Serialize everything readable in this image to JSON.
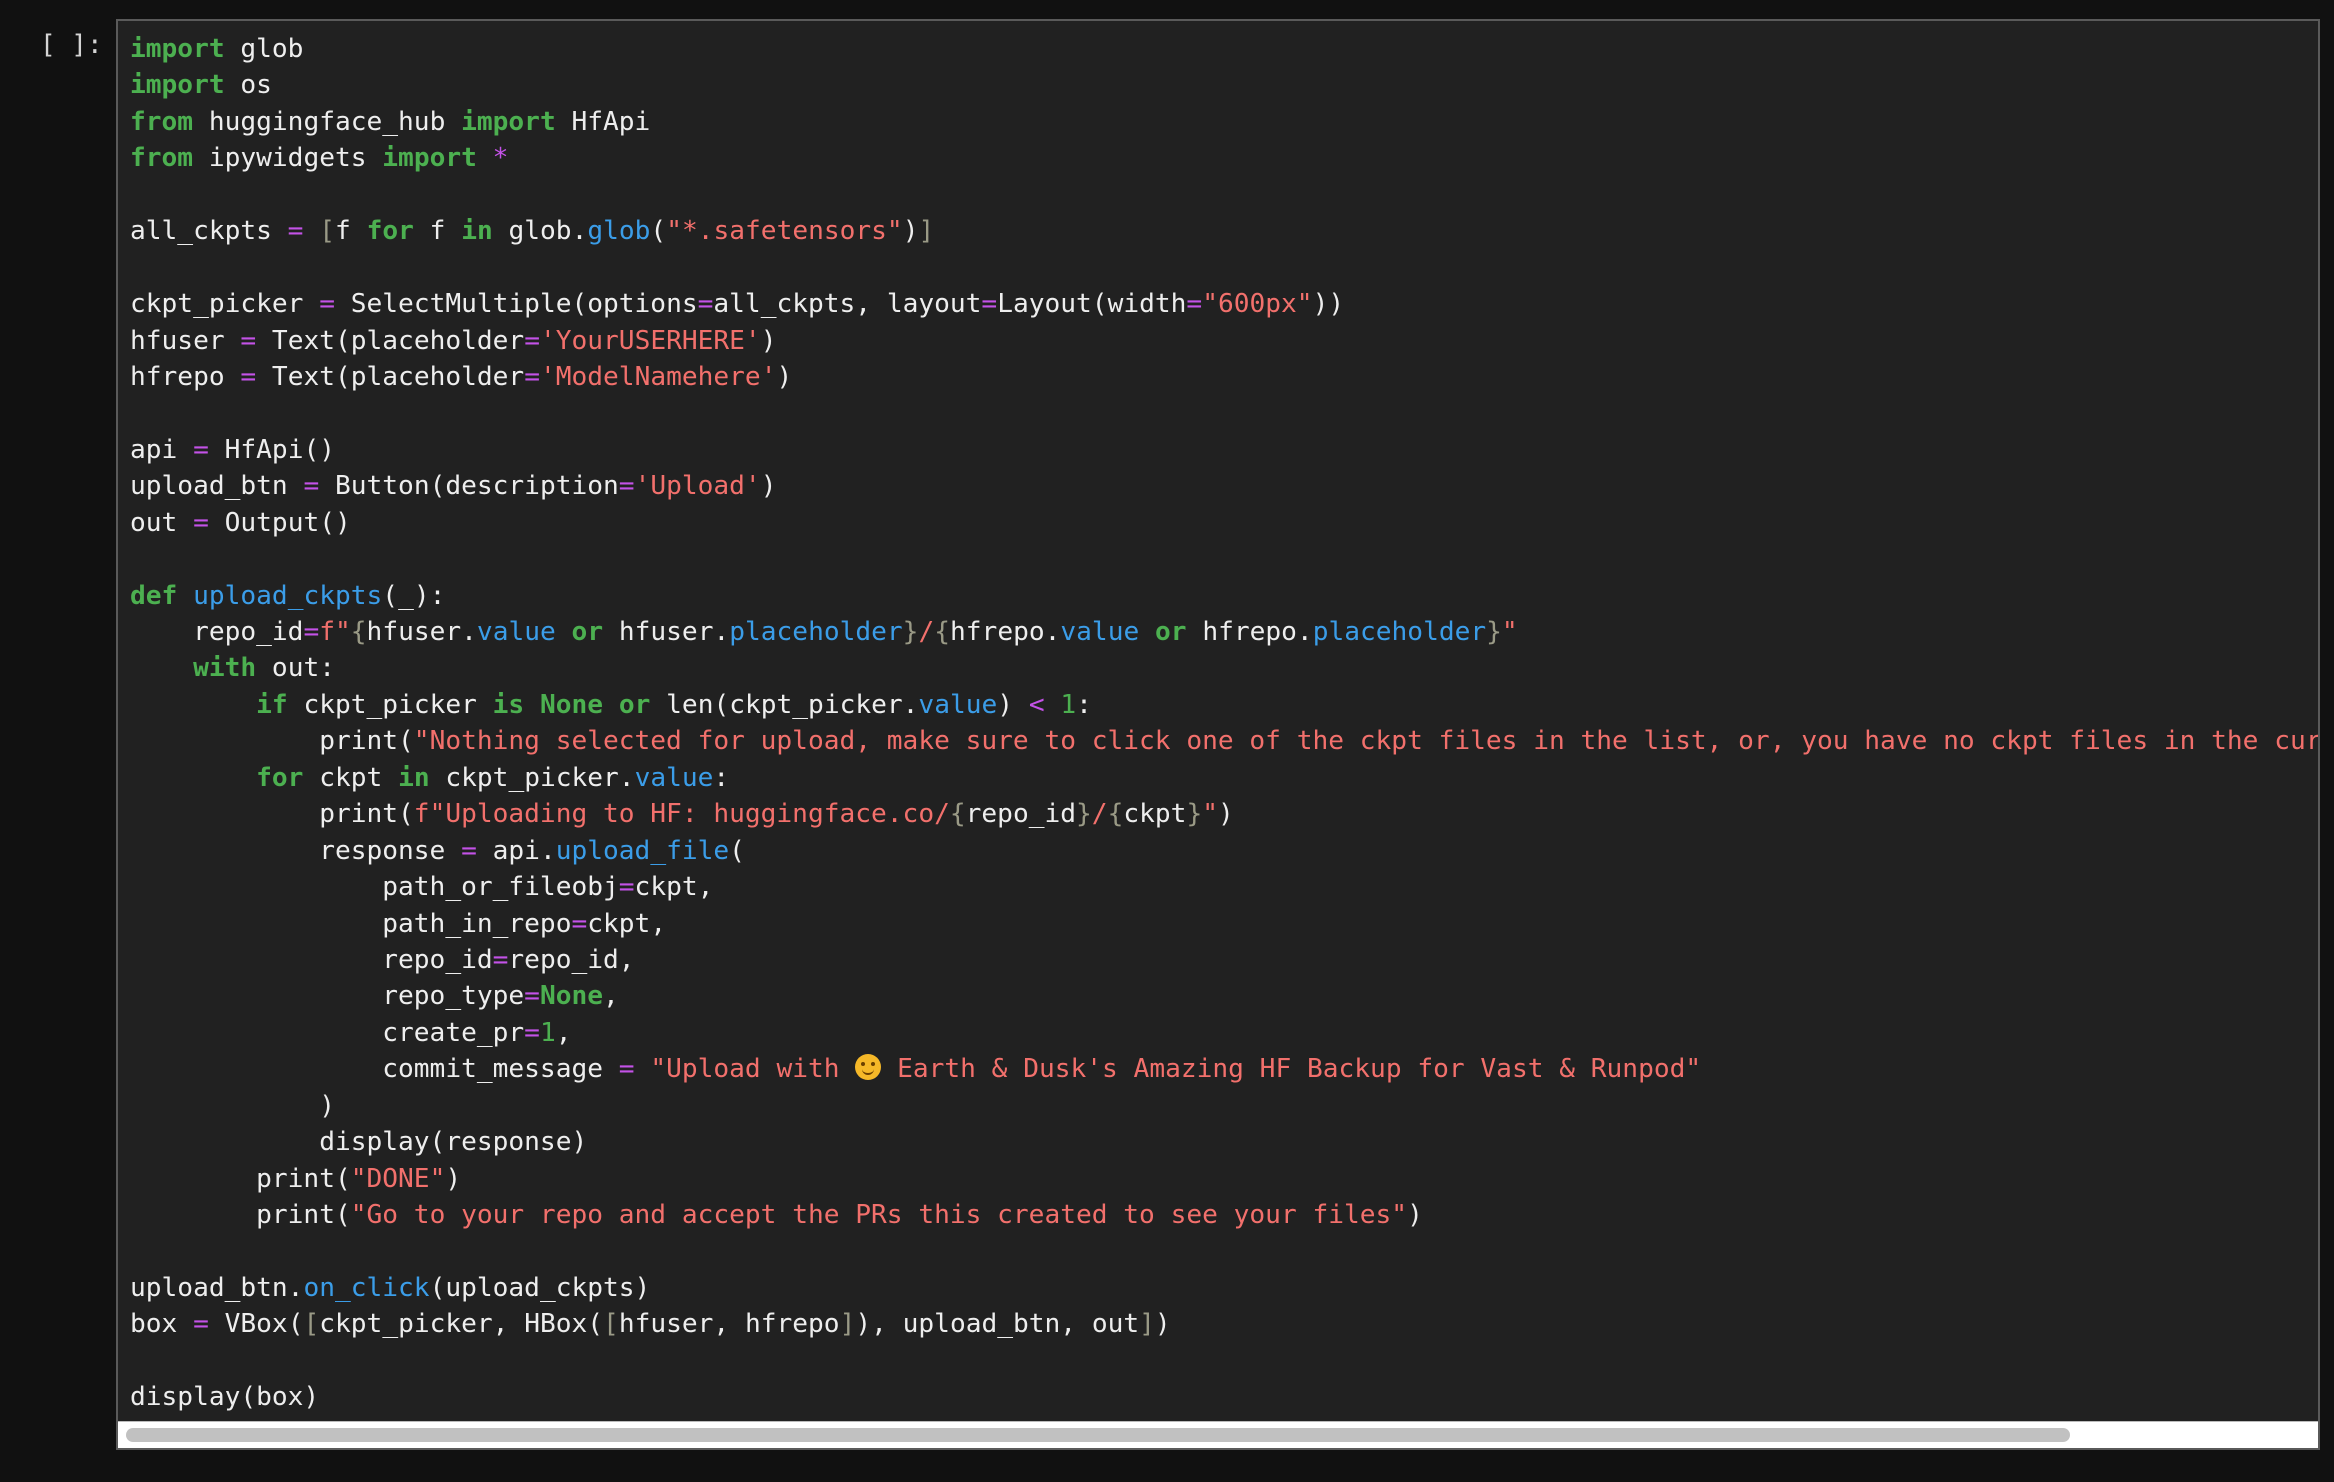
{
  "cell": {
    "prompt": "[ ]:",
    "lines": [
      [
        {
          "t": "import",
          "c": "kw"
        },
        {
          "t": " glob"
        }
      ],
      [
        {
          "t": "import",
          "c": "kw"
        },
        {
          "t": " os"
        }
      ],
      [
        {
          "t": "from",
          "c": "kw"
        },
        {
          "t": " huggingface_hub "
        },
        {
          "t": "import",
          "c": "kw"
        },
        {
          "t": " HfApi"
        }
      ],
      [
        {
          "t": "from",
          "c": "kw"
        },
        {
          "t": " ipywidgets "
        },
        {
          "t": "import",
          "c": "kw"
        },
        {
          "t": " "
        },
        {
          "t": "*",
          "c": "op"
        }
      ],
      [],
      [
        {
          "t": "all_ckpts "
        },
        {
          "t": "=",
          "c": "op"
        },
        {
          "t": " "
        },
        {
          "t": "[",
          "c": "brk"
        },
        {
          "t": "f "
        },
        {
          "t": "for",
          "c": "kw"
        },
        {
          "t": " f "
        },
        {
          "t": "in",
          "c": "kw"
        },
        {
          "t": " glob."
        },
        {
          "t": "glob",
          "c": "fn"
        },
        {
          "t": "("
        },
        {
          "t": "\"*.safetensors\"",
          "c": "str"
        },
        {
          "t": ")"
        },
        {
          "t": "]",
          "c": "brk"
        }
      ],
      [],
      [
        {
          "t": "ckpt_picker "
        },
        {
          "t": "=",
          "c": "op"
        },
        {
          "t": " SelectMultiple(options"
        },
        {
          "t": "=",
          "c": "op"
        },
        {
          "t": "all_ckpts, layout"
        },
        {
          "t": "=",
          "c": "op"
        },
        {
          "t": "Layout(width"
        },
        {
          "t": "=",
          "c": "op"
        },
        {
          "t": "\"600px\"",
          "c": "str"
        },
        {
          "t": "))"
        }
      ],
      [
        {
          "t": "hfuser "
        },
        {
          "t": "=",
          "c": "op"
        },
        {
          "t": " Text(placeholder"
        },
        {
          "t": "=",
          "c": "op"
        },
        {
          "t": "'YourUSERHERE'",
          "c": "str"
        },
        {
          "t": ")"
        }
      ],
      [
        {
          "t": "hfrepo "
        },
        {
          "t": "=",
          "c": "op"
        },
        {
          "t": " Text(placeholder"
        },
        {
          "t": "=",
          "c": "op"
        },
        {
          "t": "'ModelNamehere'",
          "c": "str"
        },
        {
          "t": ")"
        }
      ],
      [],
      [
        {
          "t": "api "
        },
        {
          "t": "=",
          "c": "op"
        },
        {
          "t": " HfApi()"
        }
      ],
      [
        {
          "t": "upload_btn "
        },
        {
          "t": "=",
          "c": "op"
        },
        {
          "t": " Button(description"
        },
        {
          "t": "=",
          "c": "op"
        },
        {
          "t": "'Upload'",
          "c": "str"
        },
        {
          "t": ")"
        }
      ],
      [
        {
          "t": "out "
        },
        {
          "t": "=",
          "c": "op"
        },
        {
          "t": " Output()"
        }
      ],
      [],
      [
        {
          "t": "def",
          "c": "kw"
        },
        {
          "t": " "
        },
        {
          "t": "upload_ckpts",
          "c": "fn"
        },
        {
          "t": "(_):"
        }
      ],
      [
        {
          "t": "    repo_id"
        },
        {
          "t": "=",
          "c": "op"
        },
        {
          "t": "f\"",
          "c": "str"
        },
        {
          "t": "{",
          "c": "brk"
        },
        {
          "t": "hfuser."
        },
        {
          "t": "value",
          "c": "fn"
        },
        {
          "t": " "
        },
        {
          "t": "or",
          "c": "kw"
        },
        {
          "t": " hfuser."
        },
        {
          "t": "placeholder",
          "c": "fn"
        },
        {
          "t": "}",
          "c": "brk"
        },
        {
          "t": "/",
          "c": "str"
        },
        {
          "t": "{",
          "c": "brk"
        },
        {
          "t": "hfrepo."
        },
        {
          "t": "value",
          "c": "fn"
        },
        {
          "t": " "
        },
        {
          "t": "or",
          "c": "kw"
        },
        {
          "t": " hfrepo."
        },
        {
          "t": "placeholder",
          "c": "fn"
        },
        {
          "t": "}",
          "c": "brk"
        },
        {
          "t": "\"",
          "c": "str"
        }
      ],
      [
        {
          "t": "    "
        },
        {
          "t": "with",
          "c": "kw"
        },
        {
          "t": " out:"
        }
      ],
      [
        {
          "t": "        "
        },
        {
          "t": "if",
          "c": "kw"
        },
        {
          "t": " ckpt_picker "
        },
        {
          "t": "is",
          "c": "kw"
        },
        {
          "t": " "
        },
        {
          "t": "None",
          "c": "kw"
        },
        {
          "t": " "
        },
        {
          "t": "or",
          "c": "kw"
        },
        {
          "t": " len(ckpt_picker."
        },
        {
          "t": "value",
          "c": "fn"
        },
        {
          "t": ") "
        },
        {
          "t": "<",
          "c": "op"
        },
        {
          "t": " "
        },
        {
          "t": "1",
          "c": "num"
        },
        {
          "t": ":"
        }
      ],
      [
        {
          "t": "            print("
        },
        {
          "t": "\"Nothing selected for upload, make sure to click one of the ckpt files in the list, or, you have no ckpt files in the curr",
          "c": "str"
        }
      ],
      [
        {
          "t": "        "
        },
        {
          "t": "for",
          "c": "kw"
        },
        {
          "t": " ckpt "
        },
        {
          "t": "in",
          "c": "kw"
        },
        {
          "t": " ckpt_picker."
        },
        {
          "t": "value",
          "c": "fn"
        },
        {
          "t": ":"
        }
      ],
      [
        {
          "t": "            print("
        },
        {
          "t": "f\"Uploading to HF: huggingface.co/",
          "c": "str"
        },
        {
          "t": "{",
          "c": "brk"
        },
        {
          "t": "repo_id"
        },
        {
          "t": "}",
          "c": "brk"
        },
        {
          "t": "/",
          "c": "str"
        },
        {
          "t": "{",
          "c": "brk"
        },
        {
          "t": "ckpt"
        },
        {
          "t": "}",
          "c": "brk"
        },
        {
          "t": "\"",
          "c": "str"
        },
        {
          "t": ")"
        }
      ],
      [
        {
          "t": "            response "
        },
        {
          "t": "=",
          "c": "op"
        },
        {
          "t": " api."
        },
        {
          "t": "upload_file",
          "c": "fn"
        },
        {
          "t": "("
        }
      ],
      [
        {
          "t": "                path_or_fileobj"
        },
        {
          "t": "=",
          "c": "op"
        },
        {
          "t": "ckpt,"
        }
      ],
      [
        {
          "t": "                path_in_repo"
        },
        {
          "t": "=",
          "c": "op"
        },
        {
          "t": "ckpt,"
        }
      ],
      [
        {
          "t": "                repo_id"
        },
        {
          "t": "=",
          "c": "op"
        },
        {
          "t": "repo_id,"
        }
      ],
      [
        {
          "t": "                repo_type"
        },
        {
          "t": "=",
          "c": "op"
        },
        {
          "t": "None",
          "c": "kw"
        },
        {
          "t": ","
        }
      ],
      [
        {
          "t": "                create_pr"
        },
        {
          "t": "=",
          "c": "op"
        },
        {
          "t": "1",
          "c": "num"
        },
        {
          "t": ","
        }
      ],
      [
        {
          "t": "                commit_message "
        },
        {
          "t": "=",
          "c": "op"
        },
        {
          "t": " "
        },
        {
          "t": "\"Upload with ",
          "c": "str"
        },
        {
          "t": "",
          "c": "emoji",
          "icon": "hugging-face-emoji-icon"
        },
        {
          "t": " Earth & Dusk's Amazing HF Backup for Vast & Runpod\"",
          "c": "str"
        }
      ],
      [
        {
          "t": "            )"
        }
      ],
      [
        {
          "t": "            display(response)"
        }
      ],
      [
        {
          "t": "        print("
        },
        {
          "t": "\"DONE\"",
          "c": "str"
        },
        {
          "t": ")"
        }
      ],
      [
        {
          "t": "        print("
        },
        {
          "t": "\"Go to your repo and accept the PRs this created to see your files\"",
          "c": "str"
        },
        {
          "t": ")"
        }
      ],
      [],
      [
        {
          "t": "upload_btn."
        },
        {
          "t": "on_click",
          "c": "fn"
        },
        {
          "t": "(upload_ckpts)"
        }
      ],
      [
        {
          "t": "box "
        },
        {
          "t": "=",
          "c": "op"
        },
        {
          "t": " VBox("
        },
        {
          "t": "[",
          "c": "brk"
        },
        {
          "t": "ckpt_picker, HBox("
        },
        {
          "t": "[",
          "c": "brk"
        },
        {
          "t": "hfuser, hfrepo"
        },
        {
          "t": "]",
          "c": "brk"
        },
        {
          "t": "), upload_btn, out"
        },
        {
          "t": "]",
          "c": "brk"
        },
        {
          "t": ")"
        }
      ],
      [],
      [
        {
          "t": "display(box)"
        }
      ]
    ]
  },
  "colors": {
    "background": "#111111",
    "editor_bg": "#212121",
    "keyword": "#4cb050",
    "operator": "#c452e8",
    "string": "#f2706c",
    "function": "#3b9de8",
    "bracket": "#9a9a86",
    "text": "#eeeeee"
  },
  "scrollbar": {
    "position_fraction": 0.0,
    "visible_fraction": 0.89
  }
}
